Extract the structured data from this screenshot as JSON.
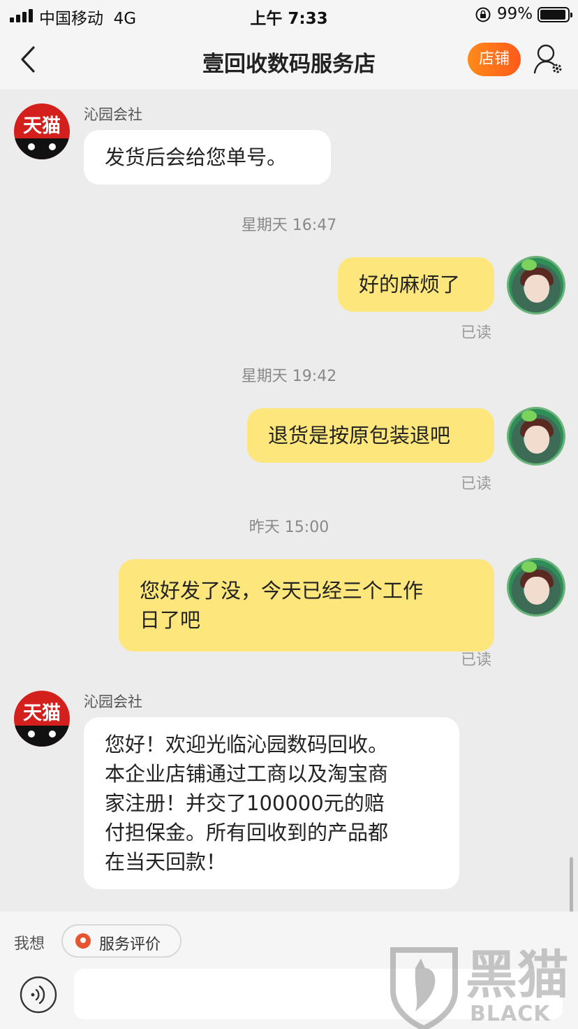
{
  "status_bar": {
    "carrier": "中国移动",
    "network": "4G",
    "time": "上午 7:33",
    "battery": "99%"
  },
  "header": {
    "title": "壹回收数码服务店",
    "shop_button": "店铺"
  },
  "messages": [
    {
      "side": "left",
      "sender": "沁园会社",
      "text": "发货后会给您单号。",
      "avatar_label": "天猫"
    },
    {
      "timestamp": "星期天 16:47"
    },
    {
      "side": "right",
      "text": "好的麻烦了",
      "status": "已读"
    },
    {
      "timestamp": "星期天 19:42"
    },
    {
      "side": "right",
      "text": "退货是按原包装退吧",
      "status": "已读"
    },
    {
      "timestamp": "昨天 15:00"
    },
    {
      "side": "right",
      "text_lines": [
        "您好发了没，今天已经三个工作",
        "日了吧"
      ],
      "status": "已读"
    },
    {
      "side": "left",
      "sender": "沁园会社",
      "avatar_label": "天猫",
      "text_lines": [
        "您好！欢迎光临沁园数码回收。",
        "本企业店铺通过工商以及淘宝商",
        "家注册！并交了100000元的赔",
        "付担保金。所有回收到的产品都",
        "在当天回款！"
      ]
    }
  ],
  "bottom": {
    "want_label": "我想",
    "rate_label": "服务评价"
  },
  "watermark": {
    "cn": "黑猫",
    "en": "BLACK CAT"
  },
  "colors": {
    "my_bubble": "#fde77c",
    "their_bubble": "#ffffff",
    "accent": "#ff6a1a",
    "tmall_red": "#d4201c"
  }
}
